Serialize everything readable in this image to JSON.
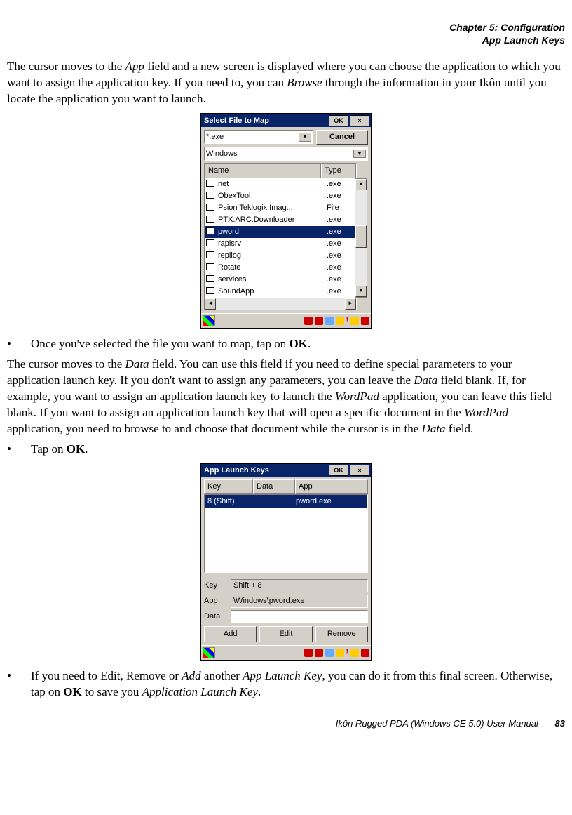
{
  "header": {
    "chapter": "Chapter 5:  Configuration",
    "section": "App Launch Keys"
  },
  "para1_a": "The cursor moves to the ",
  "para1_b": "App",
  "para1_c": " field and a new screen is displayed where you can choose the application to which you want to assign the application key. If you need to, you can ",
  "para1_d": "Browse",
  "para1_e": " through the information in your Ikôn until you locate the application you want to launch.",
  "shot1": {
    "title": "Select File to Map",
    "ok": "OK",
    "close": "×",
    "filter": "*.exe",
    "folder": "Windows",
    "cancel": "Cancel",
    "cols": {
      "name": "Name",
      "type": "Type"
    },
    "rows": [
      {
        "name": "net",
        "type": ".exe",
        "sel": false
      },
      {
        "name": "ObexTool",
        "type": ".exe",
        "sel": false
      },
      {
        "name": "Psion Teklogix Imag...",
        "type": "File",
        "sel": false
      },
      {
        "name": "PTX.ARC.Downloader",
        "type": ".exe",
        "sel": false
      },
      {
        "name": "pword",
        "type": ".exe",
        "sel": true
      },
      {
        "name": "rapisrv",
        "type": ".exe",
        "sel": false
      },
      {
        "name": "repllog",
        "type": ".exe",
        "sel": false
      },
      {
        "name": "Rotate",
        "type": ".exe",
        "sel": false
      },
      {
        "name": "services",
        "type": ".exe",
        "sel": false
      },
      {
        "name": "SoundApp",
        "type": ".exe",
        "sel": false
      }
    ]
  },
  "bullet1_a": "Once you've selected the file you want to map, tap on ",
  "bullet1_b": "OK",
  "bullet1_c": ".",
  "para2_a": "The cursor moves to the ",
  "para2_b": "Data",
  "para2_c": " field. You can use this field if you need to define special parameters to your application launch key. If you don't want to assign any parameters, you can leave the ",
  "para2_d": "Data",
  "para2_e": " field blank. If, for example, you want to assign an application launch key to launch the ",
  "para2_f": "WordPad",
  "para2_g": " application, you can leave this field blank. If you want to assign an application launch key that will open a specific document in the ",
  "para2_h": "WordPad",
  "para2_i": " application, you need to browse to and choose that document while the cursor is in the ",
  "para2_j": "Data",
  "para2_k": " field.",
  "bullet2_a": "Tap on ",
  "bullet2_b": "OK",
  "bullet2_c": ".",
  "shot2": {
    "title": "App Launch Keys",
    "ok": "OK",
    "close": "×",
    "cols": {
      "key": "Key",
      "data": "Data",
      "app": "App"
    },
    "row": {
      "key": "8 (Shift)",
      "data": "",
      "app": "pword.exe"
    },
    "form": {
      "key_label": "Key",
      "key_val": "Shift + 8",
      "app_label": "App",
      "app_val": "\\Windows\\pword.exe",
      "data_label": "Data",
      "data_val": ""
    },
    "buttons": {
      "add": "Add",
      "edit": "Edit",
      "remove": "Remove"
    }
  },
  "bullet3_a": "If you need to Edit, Remove or ",
  "bullet3_b": "Add",
  "bullet3_c": " another ",
  "bullet3_d": "App Launch Key",
  "bullet3_e": ", you can do it from this final screen. Otherwise, tap on ",
  "bullet3_f": "OK",
  "bullet3_g": " to save you ",
  "bullet3_h": "Application Launch Key",
  "bullet3_i": ".",
  "footer": {
    "text": "Ikôn Rugged PDA (Windows CE 5.0) User Manual",
    "page": "83"
  }
}
